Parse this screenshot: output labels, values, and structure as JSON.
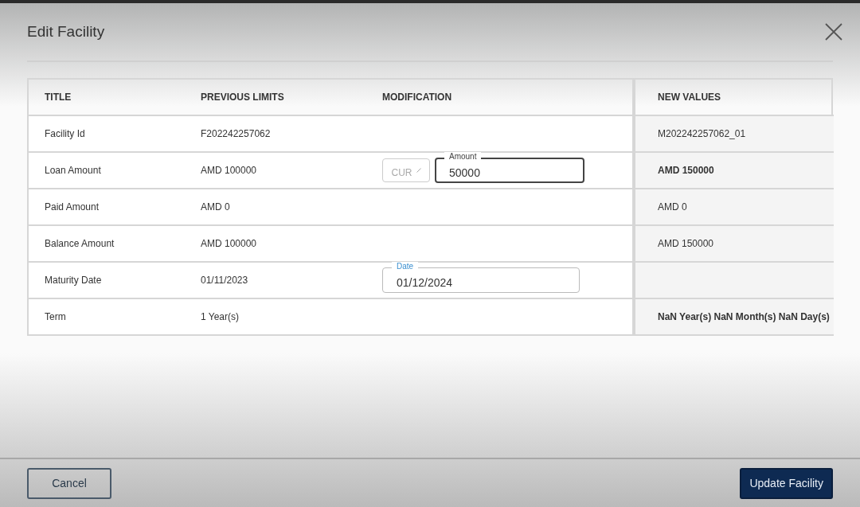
{
  "dialog": {
    "title": "Edit Facility"
  },
  "table": {
    "columns": [
      "TITLE",
      "PREVIOUS LIMITS",
      "MODIFICATION",
      "NEW VALUES"
    ],
    "rows": [
      {
        "title": "Facility Id",
        "previous": "F202242257062",
        "new_value": "M202242257062_01",
        "emphasized": false
      },
      {
        "title": "Loan Amount",
        "previous": "AMD 100000",
        "modification": {
          "kind": "amount",
          "currency_placeholder": "CUR",
          "label": "Amount",
          "value": "50000",
          "focused": true
        },
        "new_value": "AMD 150000",
        "emphasized": true
      },
      {
        "title": "Paid Amount",
        "previous": "AMD 0",
        "new_value": "AMD 0",
        "emphasized": false
      },
      {
        "title": "Balance Amount",
        "previous": "AMD 100000",
        "new_value": "AMD 150000",
        "emphasized": false
      },
      {
        "title": "Maturity Date",
        "previous": "01/11/2023",
        "modification": {
          "kind": "date",
          "label": "Date",
          "value": "01/12/2024",
          "focused": false
        }
      },
      {
        "title": "Term",
        "previous": "1 Year(s)",
        "new_value": "NaN Year(s) NaN Month(s) NaN Day(s)",
        "emphasized": true
      }
    ]
  },
  "buttons": {
    "cancel": "Cancel",
    "submit": "Update Facility"
  }
}
